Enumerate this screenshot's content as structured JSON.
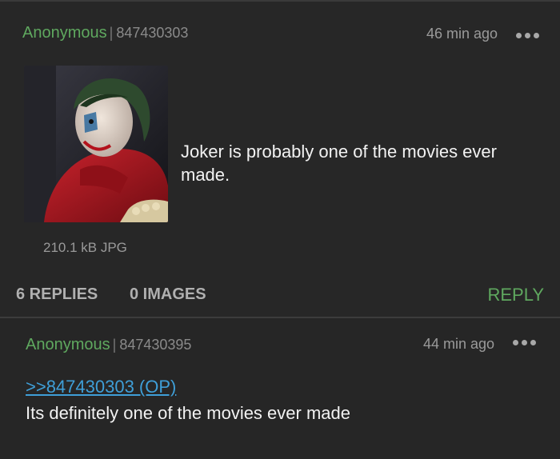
{
  "thread": {
    "op": {
      "name": "Anonymous",
      "separator": "|",
      "post_number": "847430303",
      "time_ago": "46 min ago",
      "menu_icon": "more-dots-icon",
      "image_icon": "thumbnail-image",
      "text": "Joker is probably one of the movies ever made.",
      "file_info": "210.1 kB JPG",
      "replies_label": "6 REPLIES",
      "images_label": "0 IMAGES",
      "reply_label": "REPLY"
    },
    "reply": {
      "name": "Anonymous",
      "separator": "|",
      "post_number": "847430395",
      "time_ago": "44 min ago",
      "menu_icon": "more-dots-icon",
      "quote_link": ">>847430303 (OP)",
      "text": "Its definitely one of the movies ever made"
    }
  },
  "colors": {
    "background": "#272727",
    "name_green": "#5fa85f",
    "link_blue": "#3f9fd8",
    "text": "#f2f2f2",
    "muted": "#9a9a9a"
  }
}
